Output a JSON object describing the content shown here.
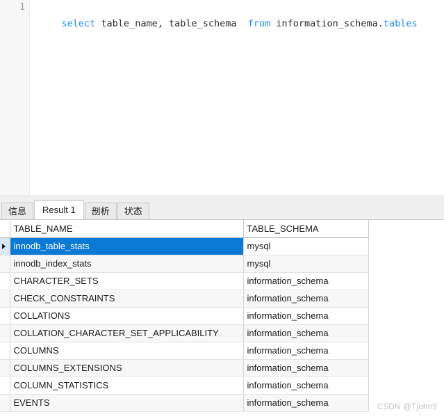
{
  "editor": {
    "line_number": "1",
    "sql_tokens": [
      {
        "text": "select",
        "type": "keyword"
      },
      {
        "text": " table_name, table_schema  ",
        "type": "identifier"
      },
      {
        "text": "from",
        "type": "keyword"
      },
      {
        "text": " information_schema.",
        "type": "identifier"
      },
      {
        "text": "tables",
        "type": "table"
      }
    ],
    "sql_plain": "select table_name, table_schema  from information_schema.tables",
    "colors": {
      "keyword": "#1a8cff",
      "identifier": "#2b2b2b",
      "table": "#1a8cff",
      "gutter_background": "#f7f7f7",
      "line_number": "#9a9a9a"
    }
  },
  "results": {
    "tabs": [
      {
        "label": "信息",
        "active": false
      },
      {
        "label": "Result 1",
        "active": true
      },
      {
        "label": "剖析",
        "active": false
      },
      {
        "label": "状态",
        "active": false
      }
    ],
    "grid": {
      "marker_icon": "row-marker-triangle",
      "columns": [
        {
          "label": "TABLE_NAME",
          "selected": true
        },
        {
          "label": "TABLE_SCHEMA",
          "selected": false
        }
      ],
      "selected_row_index": 0,
      "rows": [
        {
          "TABLE_NAME": "innodb_table_stats",
          "TABLE_SCHEMA": "mysql"
        },
        {
          "TABLE_NAME": "innodb_index_stats",
          "TABLE_SCHEMA": "mysql"
        },
        {
          "TABLE_NAME": "CHARACTER_SETS",
          "TABLE_SCHEMA": "information_schema"
        },
        {
          "TABLE_NAME": "CHECK_CONSTRAINTS",
          "TABLE_SCHEMA": "information_schema"
        },
        {
          "TABLE_NAME": "COLLATIONS",
          "TABLE_SCHEMA": "information_schema"
        },
        {
          "TABLE_NAME": "COLLATION_CHARACTER_SET_APPLICABILITY",
          "TABLE_SCHEMA": "information_schema"
        },
        {
          "TABLE_NAME": "COLUMNS",
          "TABLE_SCHEMA": "information_schema"
        },
        {
          "TABLE_NAME": "COLUMNS_EXTENSIONS",
          "TABLE_SCHEMA": "information_schema"
        },
        {
          "TABLE_NAME": "COLUMN_STATISTICS",
          "TABLE_SCHEMA": "information_schema"
        },
        {
          "TABLE_NAME": "EVENTS",
          "TABLE_SCHEMA": "information_schema"
        }
      ],
      "colors": {
        "selection": "#0b7ad4",
        "header_selected": "#cfe4f7",
        "stripe": "#f7f7f7"
      }
    }
  },
  "watermark": {
    "text": "CSDN @Tjohn9"
  }
}
